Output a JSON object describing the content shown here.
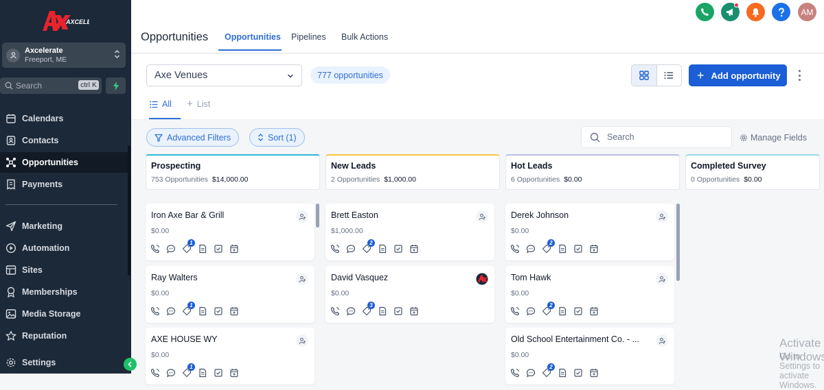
{
  "brand": {
    "logo_text": "AXCELERATE",
    "accent": "#1b5ed6",
    "nav_bg": "#1c2938"
  },
  "account": {
    "name": "Axcelerate",
    "location": "Freeport, ME"
  },
  "sidebar": {
    "search_placeholder": "Search",
    "search_shortcut": "ctrl K",
    "items": [
      {
        "label": "Calendars",
        "icon": "calendar-icon"
      },
      {
        "label": "Contacts",
        "icon": "contacts-icon"
      },
      {
        "label": "Opportunities",
        "icon": "opportunities-icon",
        "active": true
      },
      {
        "label": "Payments",
        "icon": "payments-icon"
      },
      {
        "label": "Marketing",
        "icon": "send-icon"
      },
      {
        "label": "Automation",
        "icon": "automation-icon"
      },
      {
        "label": "Sites",
        "icon": "sites-icon"
      },
      {
        "label": "Memberships",
        "icon": "memberships-icon"
      },
      {
        "label": "Media Storage",
        "icon": "image-icon"
      },
      {
        "label": "Reputation",
        "icon": "star-icon"
      },
      {
        "label": "Settings",
        "icon": "gear-icon"
      }
    ]
  },
  "header": {
    "title": "Opportunities",
    "tabs": [
      "Opportunities",
      "Pipelines",
      "Bulk Actions"
    ],
    "avatar_initials": "AM"
  },
  "toolbar": {
    "pipeline": "Axe Venues",
    "count": "777 opportunities",
    "add_label": "Add opportunity",
    "subtab_all": "All",
    "subtab_list": "List",
    "advanced_filters": "Advanced Filters",
    "sort": "Sort (1)",
    "search_placeholder": "Search",
    "manage_fields": "Manage Fields"
  },
  "stages": [
    {
      "name": "Prospecting",
      "count": "753 Opportunities",
      "value": "$14,000.00",
      "color": "#2ab7d4"
    },
    {
      "name": "New Leads",
      "count": "2 Opportunities",
      "value": "$1,000.00",
      "color": "#f5c542"
    },
    {
      "name": "Hot Leads",
      "count": "6 Opportunities",
      "value": "$0.00",
      "color": "#b9bde6"
    },
    {
      "name": "Completed Survey",
      "count": "0 Opportunities",
      "value": "$0.00",
      "color": "#9ad7e8"
    }
  ],
  "cards": {
    "prospecting": [
      {
        "name": "Iron Axe Bar & Grill",
        "amount": "$0.00",
        "badge": "1"
      },
      {
        "name": "Ray Walters",
        "amount": "$0.00",
        "badge": "1"
      },
      {
        "name": "AXE HOUSE WY",
        "amount": "$0.00",
        "badge": "1"
      }
    ],
    "new_leads": [
      {
        "name": "Brett Easton",
        "amount": "$1,000.00",
        "badge": "2"
      },
      {
        "name": "David Vasquez",
        "amount": "$0.00",
        "badge": "3"
      }
    ],
    "hot_leads": [
      {
        "name": "Derek Johnson",
        "amount": "$0.00",
        "badge": "2"
      },
      {
        "name": "Tom Hawk",
        "amount": "$0.00",
        "badge": "2"
      },
      {
        "name": "Old School Entertainment Co. - ...",
        "amount": "$0.00",
        "badge": "2"
      }
    ]
  },
  "watermark": {
    "line1": "Activate Windows",
    "line2": "Go to Settings to activate Windows."
  }
}
